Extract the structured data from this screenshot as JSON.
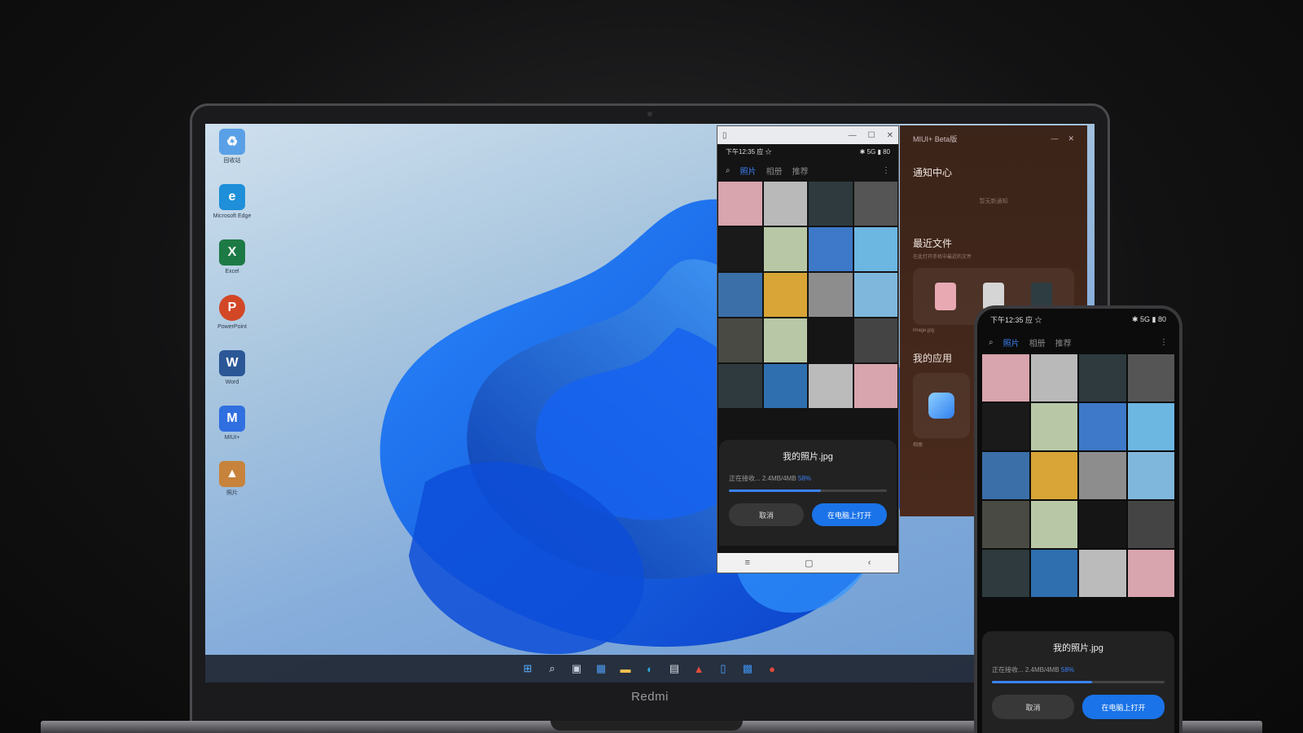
{
  "laptop": {
    "brand": "Redmi"
  },
  "desktop": {
    "icons": [
      {
        "name": "recycle-bin",
        "label": "回收站",
        "color": "#5aa0e6",
        "glyph": "♻"
      },
      {
        "name": "edge",
        "label": "Microsoft Edge",
        "color": "#1e8fd8",
        "glyph": "e"
      },
      {
        "name": "excel",
        "label": "Excel",
        "color": "#1d7a45",
        "glyph": "X"
      },
      {
        "name": "powerpoint",
        "label": "PowerPoint",
        "color": "#d24726",
        "glyph": "P"
      },
      {
        "name": "word",
        "label": "Word",
        "color": "#2b5797",
        "glyph": "W"
      },
      {
        "name": "miui-plus",
        "label": "MIUI+",
        "color": "#2f6fe0",
        "glyph": "M"
      },
      {
        "name": "photos",
        "label": "照片",
        "color": "#c7833b",
        "glyph": "▲"
      }
    ]
  },
  "taskbar": {
    "icons": [
      {
        "name": "start-icon",
        "glyph": "⊞",
        "color": "#5ab0ff"
      },
      {
        "name": "search-icon",
        "glyph": "⌕",
        "color": "#e8eef5"
      },
      {
        "name": "task-view-icon",
        "glyph": "▣",
        "color": "#c9d3df"
      },
      {
        "name": "widgets-icon",
        "glyph": "▦",
        "color": "#4c9cf0"
      },
      {
        "name": "file-explorer-icon",
        "glyph": "▬",
        "color": "#f2c14e"
      },
      {
        "name": "edge-icon",
        "glyph": "◐",
        "color": "#2ea7e0"
      },
      {
        "name": "store-icon",
        "glyph": "▤",
        "color": "#d9dfe7"
      },
      {
        "name": "office-icon",
        "glyph": "▲",
        "color": "#e14b3b"
      },
      {
        "name": "phone-mirror-icon",
        "glyph": "▯",
        "color": "#4fa3ff"
      },
      {
        "name": "miui-plus-icon",
        "glyph": "▩",
        "color": "#3c8ee8"
      },
      {
        "name": "app-icon",
        "glyph": "●",
        "color": "#e0483a"
      }
    ],
    "tray": "^  ⌁"
  },
  "mirror": {
    "title_controls": [
      "—",
      "☐",
      "✕"
    ],
    "status_left": "下午12:35 应 ☆",
    "status_right": "✱ 5G ▮ 80",
    "tabs": [
      "照片",
      "相册",
      "推荐"
    ],
    "active_tab": "照片",
    "more": "⋮",
    "transfer": {
      "filename": "我的照片.jpg",
      "status": "正在接收... 2.4MB/4MB",
      "percent_text": "58%",
      "progress": 0.58,
      "cancel_label": "取消",
      "open_label": "在电脑上打开"
    },
    "nav": [
      "≡",
      "▢",
      "‹"
    ]
  },
  "miui_panel": {
    "title": "MIUI+ Beta版",
    "controls": [
      "—",
      "✕"
    ],
    "notification_center": "通知中心",
    "no_notifications": "暂无新通知",
    "recent_files": "最近文件",
    "recent_files_sub": "在此打开手机中最近的文件",
    "recent_file_label": "image.jpg",
    "my_apps": "我的应用",
    "app_label": "相册"
  },
  "phone": {
    "status_left": "下午12:35 应 ☆",
    "status_right": "✱ 5G ▮ 80",
    "tabs": [
      "照片",
      "相册",
      "推荐"
    ],
    "more": "⋮",
    "transfer": {
      "filename": "我的照片.jpg",
      "status": "正在接收... 2.4MB/4MB",
      "percent_text": "58%",
      "progress": 0.58,
      "cancel_label": "取消",
      "open_label": "在电脑上打开"
    }
  },
  "photo_colors": [
    "#d8a4ad",
    "#b9b9b9",
    "#2e3a3e",
    "#555",
    "#1a1a1a",
    "#b8c8a6",
    "#3d79c8",
    "#6cb6e2",
    "#3b6fa8",
    "#d8a536",
    "#8d8d8d",
    "#7fb7dc",
    "#4a4a44",
    "#b8c8a6",
    "#151515",
    "#444",
    "#2e3a3e",
    "#2f6fb0",
    "#bbbbbb",
    "#d8a4ad"
  ]
}
